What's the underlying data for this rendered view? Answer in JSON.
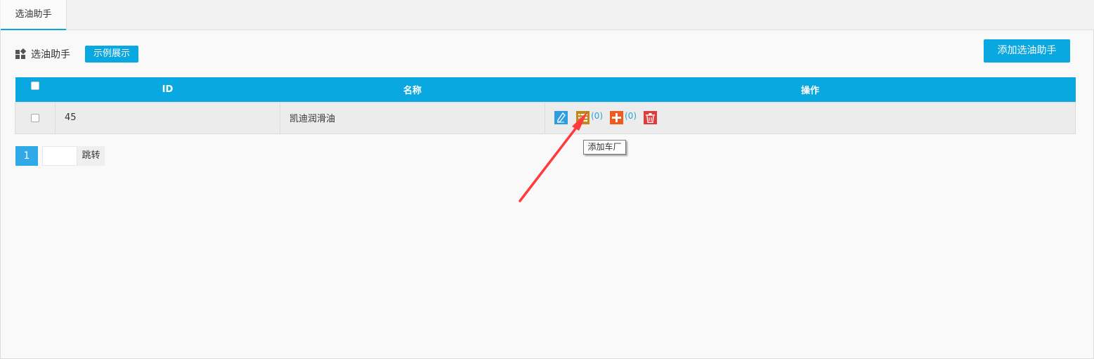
{
  "tabs": [
    {
      "label": "选油助手"
    }
  ],
  "header": {
    "title": "选油助手",
    "demo_button": "示例展示",
    "add_button": "添加选油助手"
  },
  "table": {
    "columns": [
      "ID",
      "名称",
      "操作"
    ],
    "rows": [
      {
        "id": "45",
        "name": "凯迪润滑油",
        "list_count": "(0)",
        "plus_count": "(0)"
      }
    ]
  },
  "tooltip": {
    "text": "添加车厂"
  },
  "pager": {
    "current_page": "1",
    "jump_input": "",
    "jump_label": "跳转"
  },
  "colors": {
    "accent": "#09a8e0",
    "edit": "#2f9be0",
    "list": "#c08a1a",
    "add": "#f05a1e",
    "delete": "#e13b3b",
    "annotation_arrow": "#ff3b3b"
  }
}
